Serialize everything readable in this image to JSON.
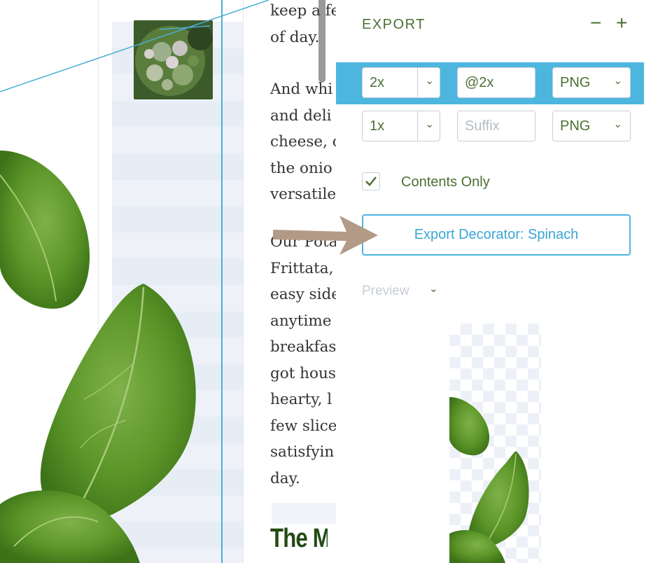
{
  "canvas": {
    "paragraph1": [
      "keep a fe",
      "of day."
    ],
    "paragraph2": [
      "And whi",
      "and deli",
      "cheese, c",
      "the onio",
      "versatile"
    ],
    "paragraph3": [
      "Our Pota",
      "Frittata,",
      "easy side",
      "anytime",
      "breakfas",
      "got hous",
      "hearty, l",
      "few slice",
      "satisfyin",
      "day."
    ],
    "heading": "The Me"
  },
  "panel": {
    "title": "EXPORT",
    "collapse_symbol": "−",
    "add_symbol": "+",
    "rows": [
      {
        "scale": "2x",
        "suffix": "@2x",
        "suffix_placeholder": "",
        "format": "PNG",
        "selected": true
      },
      {
        "scale": "1x",
        "suffix": "",
        "suffix_placeholder": "Suffix",
        "format": "PNG",
        "selected": false
      }
    ],
    "contents_only": {
      "label": "Contents Only",
      "checked": true
    },
    "export_button": "Export Decorator: Spinach",
    "preview_label": "Preview",
    "chevron_glyph": "⌄"
  },
  "icons": {
    "collapse": "minus-icon",
    "add": "plus-icon",
    "dropdown": "chevron-down-icon",
    "check": "checkmark-icon",
    "arrow": "pointer-arrow-icon"
  },
  "colors": {
    "accent": "#4cb6de",
    "text_green": "#4c6f34",
    "heading_green": "#234a14",
    "leaf": "#5e9a2e",
    "arrow": "#b39a86"
  }
}
